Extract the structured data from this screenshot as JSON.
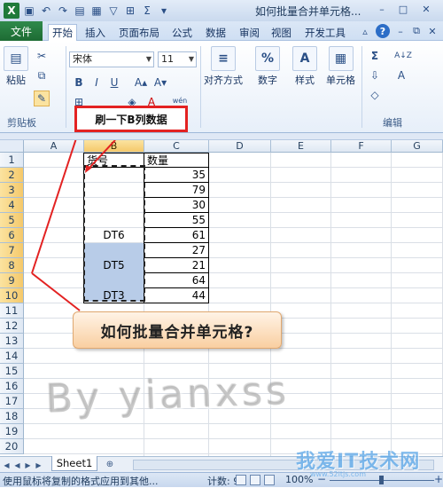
{
  "window": {
    "title": "如何批量合并单元格...",
    "excel_icon": "X"
  },
  "tabs": [
    "文件",
    "开始",
    "插入",
    "页面布局",
    "公式",
    "数据",
    "审阅",
    "视图",
    "开发工具"
  ],
  "ribbon": {
    "paste_label": "粘贴",
    "clipboard_group": "剪贴板",
    "font_name": "宋体",
    "font_size": "11",
    "bold": "B",
    "italic": "I",
    "underline": "U",
    "wen": "wén",
    "align_label": "对齐方式",
    "number_label": "数字",
    "style_label": "样式",
    "cells_label": "单元格",
    "edit_group": "编辑",
    "sigma": "Σ",
    "sort_icon": "A↓Z",
    "find_icon": "A"
  },
  "callout": "刷一下B列数据",
  "columns": [
    "A",
    "B",
    "C",
    "D",
    "E",
    "F",
    "G"
  ],
  "rows": [
    "1",
    "2",
    "3",
    "4",
    "5",
    "6",
    "7",
    "8",
    "9",
    "10",
    "11",
    "12",
    "13",
    "14",
    "15",
    "16",
    "17",
    "18",
    "19",
    "20"
  ],
  "table": {
    "header_b": "货号",
    "header_c": "数量",
    "c_values": [
      "35",
      "79",
      "30",
      "55",
      "61",
      "27",
      "21",
      "64",
      "44"
    ],
    "b_labels": [
      "DT6",
      "DT5",
      "DT3"
    ]
  },
  "banner": "如何批量合并单元格?",
  "watermark": "By yianxss",
  "sheet": {
    "name": "Sheet1"
  },
  "status": {
    "message": "使用鼠标将复制的格式应用到其他...",
    "count": "计数: 9",
    "zoom": "100%",
    "minus": "−",
    "plus": "+"
  },
  "site": {
    "name": "我爱IT技术网",
    "url": "www.52itjs.com"
  },
  "colors": {
    "file_tab": "#1d6b33",
    "selection_blue": "#b8cce8",
    "callout_red": "#e32222",
    "header_highlight": "#f5c96b"
  }
}
